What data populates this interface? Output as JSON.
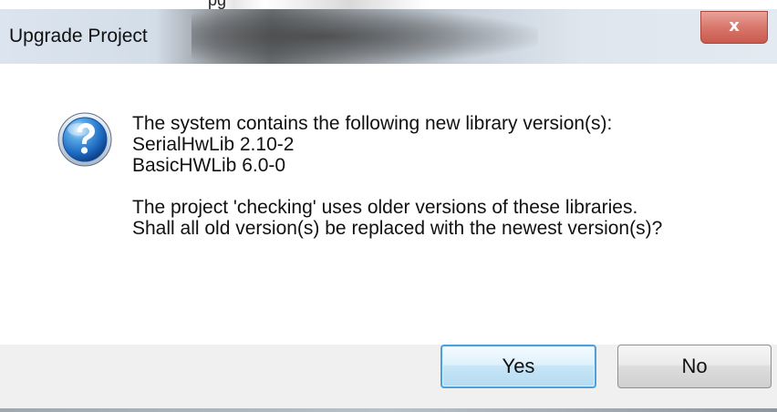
{
  "top_strip": {
    "text": "pg"
  },
  "window": {
    "title": "Upgrade Project",
    "close_glyph": "x",
    "icon": "question-icon"
  },
  "message": {
    "line1": "The system contains the following new library version(s):",
    "line2": "SerialHwLib 2.10-2",
    "line3": "BasicHWLib 6.0-0",
    "line4": "The project 'checking' uses older versions of these libraries.",
    "line5": "Shall all old version(s) be replaced with the newest version(s)?"
  },
  "buttons": {
    "yes": "Yes",
    "no": "No"
  },
  "colors": {
    "accent": "#4f9fd8",
    "close_button": "#d9766b",
    "icon": "#1f6ec2"
  }
}
